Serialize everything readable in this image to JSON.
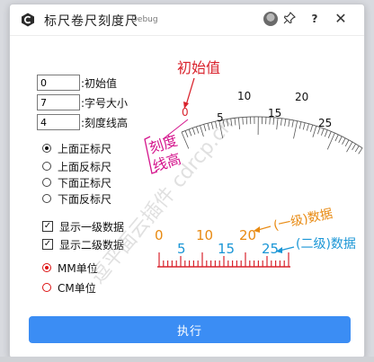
{
  "window": {
    "title": "标尺卷尺刻度尺",
    "badge": "Debug"
  },
  "titlebar_icons": {
    "pin": "pin-icon",
    "help": "?",
    "close": "✕"
  },
  "fields": [
    {
      "value": "0",
      "label": ":初始值"
    },
    {
      "value": "7",
      "label": ":字号大小"
    },
    {
      "value": "4",
      "label": ":刻度线高"
    }
  ],
  "ruler_position": {
    "options": [
      "上面正标尺",
      "上面反标尺",
      "下面正标尺",
      "下面反标尺"
    ],
    "selected": 0
  },
  "data_options": [
    {
      "label": "显示一级数据",
      "checked": true
    },
    {
      "label": "显示二级数据",
      "checked": true
    }
  ],
  "unit": {
    "options": [
      "MM单位",
      "CM单位"
    ],
    "selected": 0
  },
  "execute_label": "执行",
  "illustration": {
    "initial_label": "初始值",
    "tick_height_label_1": "刻度",
    "tick_height_label_2": "线高",
    "level1_label": "(一级)数据",
    "level2_label": "(二级)数据",
    "watermark": "逗平面云插件 cdrcp.cn",
    "arc_major_labels": [
      "0",
      "10",
      "20"
    ],
    "arc_minor_labels": [
      "5",
      "15",
      "25"
    ],
    "ruler_major_labels": [
      "0",
      "10",
      "20"
    ],
    "ruler_minor_labels": [
      "5",
      "15",
      "25"
    ],
    "colors": {
      "red": "#d9232d",
      "magenta": "#d4148c",
      "orange": "#e88a12",
      "blue": "#1a96d6",
      "gray": "#888888"
    }
  }
}
